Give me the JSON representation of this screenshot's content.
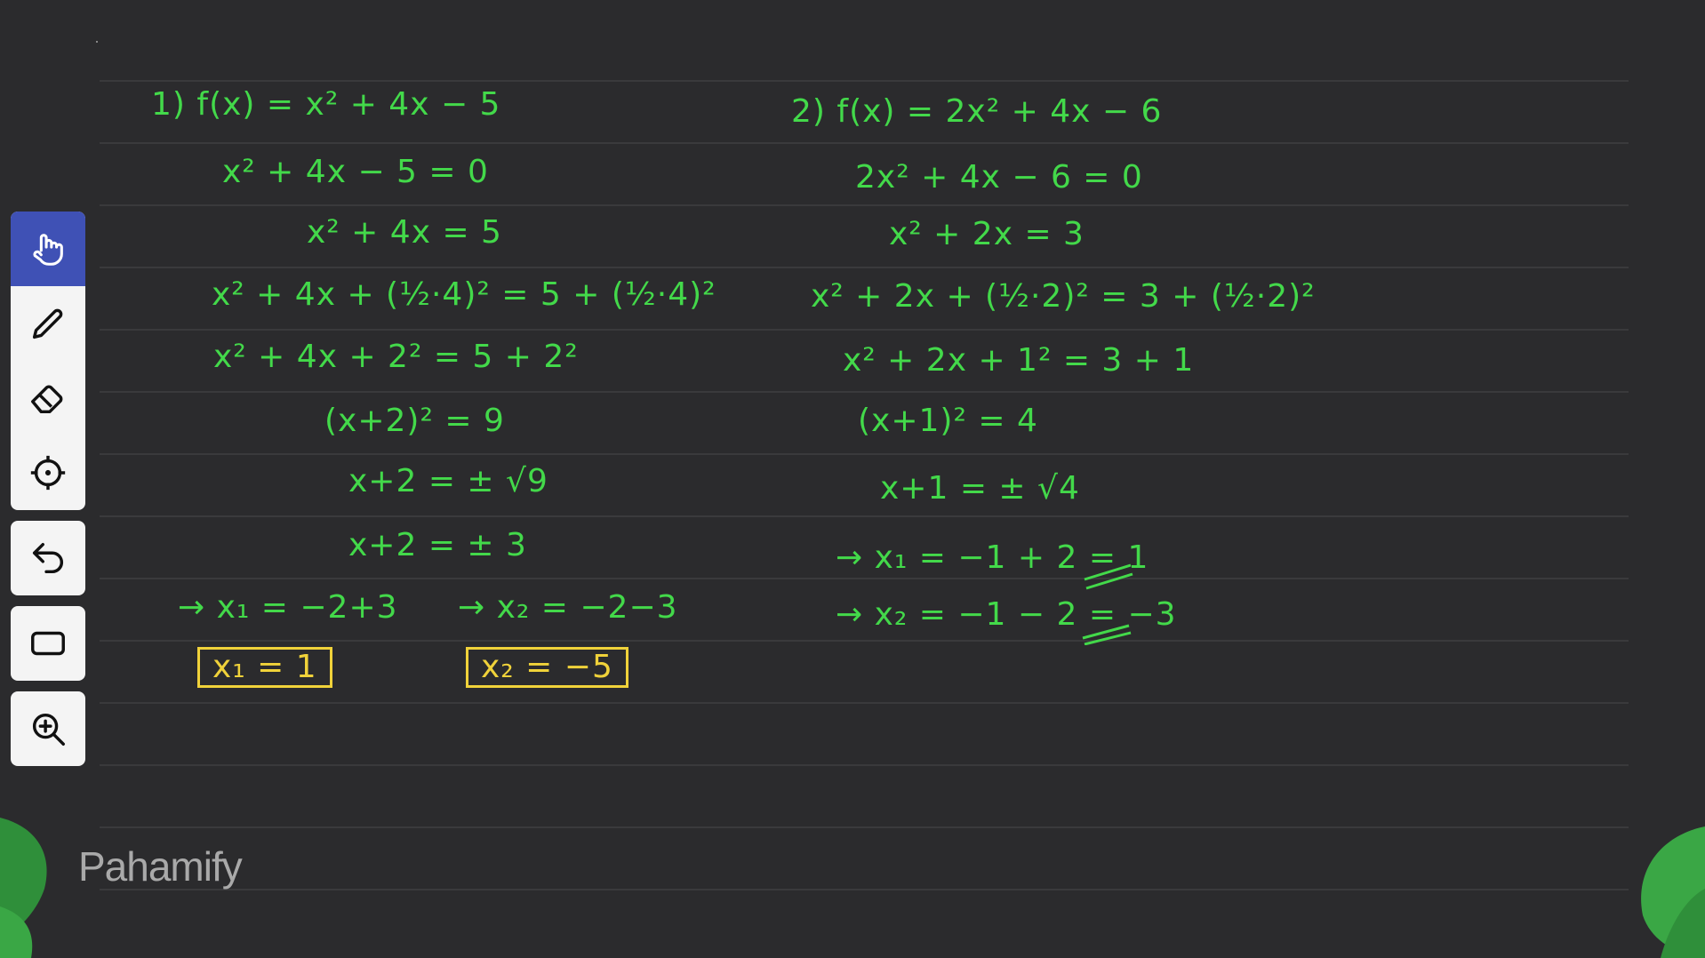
{
  "left_problem": {
    "lines": [
      "1) f(x) = x² + 4x − 5",
      "x² + 4x − 5 = 0",
      "x² + 4x = 5",
      "x² + 4x + (½·4)² = 5 + (½·4)²",
      "x² + 4x + 2² = 5 + 2²",
      "(x+2)² = 9",
      "x+2 = ± √9",
      "x+2 = ± 3",
      "→ x₁ = −2+3",
      "→ x₂ = −2−3"
    ],
    "answer_x1": "x₁ = 1",
    "answer_x2": "x₂ = −5"
  },
  "right_problem": {
    "lines": [
      "2) f(x) = 2x² + 4x − 6",
      "2x² + 4x − 6 = 0",
      "x² + 2x = 3",
      "x² + 2x + (½·2)² = 3 + (½·2)²",
      "x² + 2x + 1² = 3 + 1",
      "(x+1)² = 4",
      "x+1 = ± √4",
      "→ x₁ = −1 + 2 = 1",
      "→ x₂ = −1 − 2 = −3"
    ]
  },
  "toolbar": {
    "tools": [
      "hand-icon",
      "pen-icon",
      "eraser-icon",
      "laser-pointer-icon"
    ],
    "active": "hand-icon",
    "undo": "undo-icon",
    "shape": "rectangle-icon",
    "zoom": "zoom-in-icon"
  },
  "brand": {
    "logo_text": "Pahamify"
  },
  "colors": {
    "background": "#2b2b2d",
    "ink_green": "#43d94a",
    "ink_yellow": "#f0d23a",
    "active_tool": "#3f51b5"
  }
}
